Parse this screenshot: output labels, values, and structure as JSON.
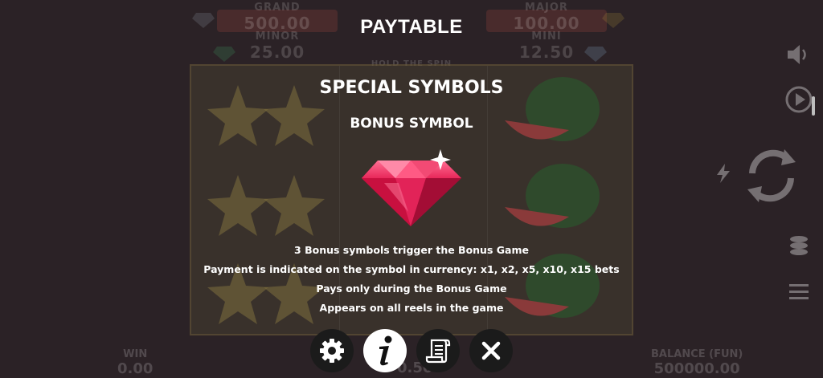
{
  "background": {
    "jackpots": {
      "grand": {
        "name": "GRAND",
        "value": "500.00"
      },
      "major": {
        "name": "MAJOR",
        "value": "100.00"
      },
      "minor": {
        "name": "MINOR",
        "value": "25.00"
      },
      "mini": {
        "name": "MINI",
        "value": "12.50"
      }
    },
    "logo_subtitle": "HOLD THE SPIN",
    "win": {
      "name": "WIN",
      "value": "0.00"
    },
    "bet": {
      "value": "0.50"
    },
    "balance": {
      "name": "BALANCE (FUN)",
      "value": "500000.00"
    }
  },
  "paytable": {
    "title": "PAYTABLE",
    "section_title": "SPECIAL SYMBOLS",
    "symbol_title": "BONUS SYMBOL",
    "symbol_icon": "ruby-gem-icon",
    "descriptions": [
      "3 Bonus symbols trigger the Bonus Game",
      "Payment is indicated on the symbol in currency: x1, x2, x5, x10, x15 bets",
      "Pays only during the Bonus Game",
      "Appears on all reels in the game"
    ]
  },
  "controls": {
    "settings_icon": "gear-icon",
    "info_icon": "info-icon",
    "rules_icon": "scroll-icon",
    "close_icon": "close-icon"
  },
  "colors": {
    "gem": "#e8285a",
    "button_bg": "#1b1b1b",
    "active_button_bg": "#ffffff"
  }
}
